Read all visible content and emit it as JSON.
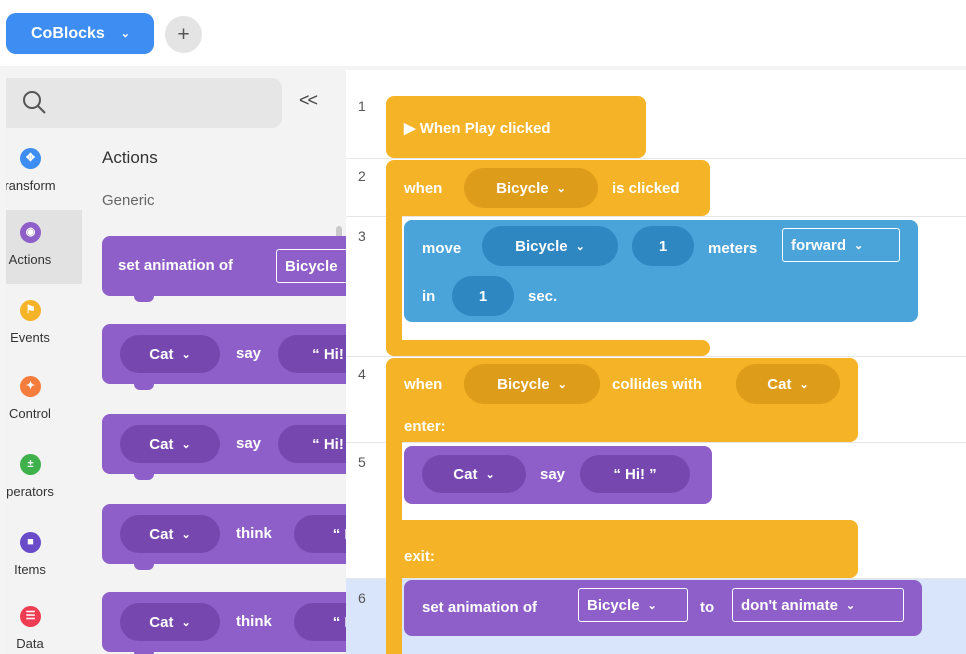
{
  "topbar": {
    "app_tab_label": "CoBlocks",
    "add_tab_label": "+"
  },
  "palette": {
    "collapse_label": "<<",
    "title": "Actions",
    "subtitle": "Generic",
    "categories": [
      {
        "label": "ransform",
        "icon": "transform-icon",
        "color": "#3d8df2"
      },
      {
        "label": "Actions",
        "icon": "actions-icon",
        "color": "#8e5fc8"
      },
      {
        "label": "Events",
        "icon": "events-icon",
        "color": "#f5b428"
      },
      {
        "label": "Control",
        "icon": "control-icon",
        "color": "#f47c3c"
      },
      {
        "label": "perators",
        "icon": "operators-icon",
        "color": "#3fb14b"
      },
      {
        "label": "Items",
        "icon": "items-icon",
        "color": "#6a4cc8"
      },
      {
        "label": "Data",
        "icon": "data-icon",
        "color": "#ee3d53"
      }
    ],
    "blocks": [
      {
        "text": "set animation of",
        "arg": "Bicycle"
      },
      {
        "subject": "Cat",
        "verb": "say",
        "arg": "“ Hi!"
      },
      {
        "subject": "Cat",
        "verb": "say",
        "arg": "“ Hi!"
      },
      {
        "subject": "Cat",
        "verb": "think",
        "arg": "“ H"
      },
      {
        "subject": "Cat",
        "verb": "think",
        "arg": "“ H"
      }
    ]
  },
  "editor": {
    "line_numbers": [
      "1",
      "2",
      "3",
      "4",
      "5",
      "6"
    ],
    "play_block": "▶ When Play clicked",
    "when": "when",
    "is_clicked": "is clicked",
    "sprite_bicycle": "Bicycle",
    "move": "move",
    "move_amount": "1",
    "meters": "meters",
    "direction": "forward",
    "in": "in",
    "duration": "1",
    "sec": "sec.",
    "collides_with": "collides with",
    "sprite_cat": "Cat",
    "enter": "enter:",
    "say": "say",
    "say_text": "“ Hi! ”",
    "exit": "exit:",
    "set_animation_of": "set animation of",
    "to": "to",
    "animation": "don't animate"
  },
  "colors": {
    "accent": "#3d8df2",
    "events": "#f5b428",
    "motion": "#4aa3d9",
    "looks": "#8e5fc8",
    "highlight_line": "#d9e5fa"
  }
}
